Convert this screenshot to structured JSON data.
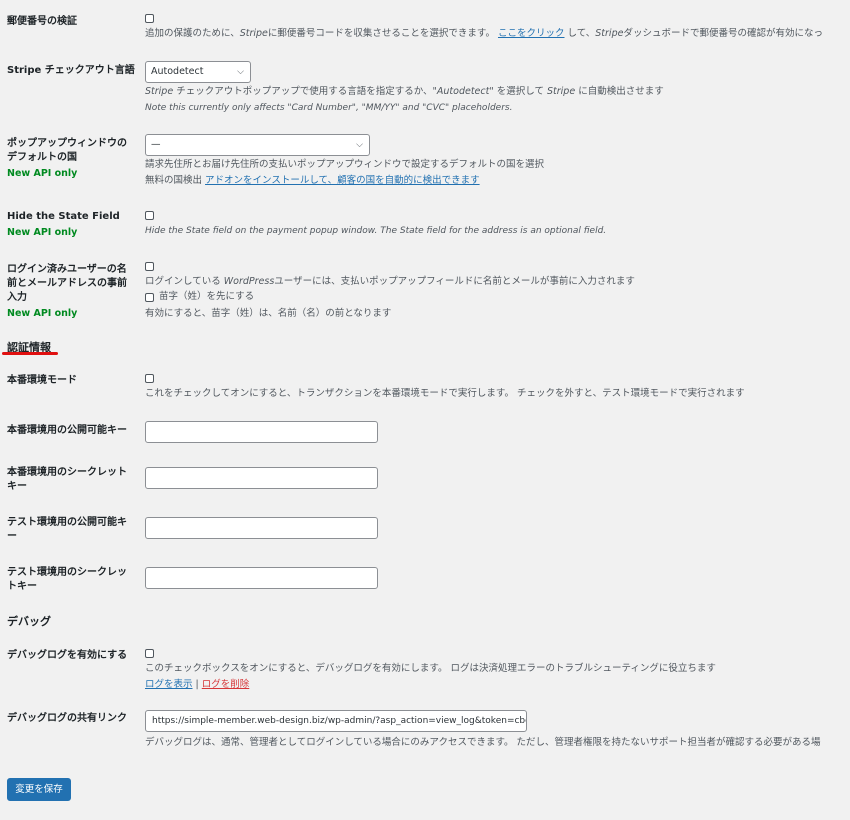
{
  "postal": {
    "label": "郵便番号の検証",
    "desc_pre": "追加の保護のために、",
    "desc_stripe": "Stripe",
    "desc_mid": "に郵便番号コードを収集させることを選択できます。 ",
    "desc_link": "ここをクリック",
    "desc_post": " して、",
    "desc_stripe2": "Stripe",
    "desc_end": "ダッシュボードで郵便番号の確認が有効になっ"
  },
  "checkout_lang": {
    "label": "Stripe チェックアウト言語",
    "value": "Autodetect",
    "desc1_a": "Stripe",
    "desc1_b": " チェックアウトポップアップで使用する言語を指定するか、",
    "desc1_c": "\"Autodetect\"",
    "desc1_d": " を選択して ",
    "desc1_e": "Stripe",
    "desc1_f": " に自動検出させます",
    "desc2": "Note this currently only affects \"Card Number\", \"MM/YY\" and \"CVC\" placeholders."
  },
  "default_country": {
    "label": "ポップアップウィンドウのデフォルトの国",
    "badge": "New API only",
    "value": "—",
    "desc1": "請求先住所とお届け先住所の支払いポップアップウィンドウで設定するデフォルトの国を選択",
    "desc2_pre": "無料の国検出 ",
    "desc2_link": "アドオンをインストールして、顧客の国を自動的に検出できます"
  },
  "hide_state": {
    "label": "Hide the State Field",
    "badge": "New API only",
    "desc": "Hide the State field on the payment popup window. The State field for the address is an optional field."
  },
  "prefill": {
    "label": "ログイン済みユーザーの名前とメールアドレスの事前入力",
    "badge": "New API only",
    "desc_a": "ログインしている ",
    "desc_b": "WordPress",
    "desc_c": "ユーザーには、支払いポップアップフィールドに名前とメールが事前に入力されます",
    "sub_label": "苗字（姓）を先にする",
    "sub_desc": "有効にすると、苗字（姓）は、名前（名）の前となります"
  },
  "auth_section": {
    "title": "認証情報"
  },
  "live_mode": {
    "label": "本番環境モード",
    "desc": "これをチェックしてオンにすると、トランザクションを本番環境モードで実行します。 チェックを外すと、テスト環境モードで実行されます"
  },
  "live_pub": {
    "label": "本番環境用の公開可能キー",
    "value": ""
  },
  "live_secret": {
    "label": "本番環境用のシークレットキー",
    "value": ""
  },
  "test_pub": {
    "label": "テスト環境用の公開可能キー",
    "value": ""
  },
  "test_secret": {
    "label": "テスト環境用のシークレットキー",
    "value": ""
  },
  "debug_section": {
    "title": "デバッグ"
  },
  "debug_enable": {
    "label": "デバッグログを有効にする",
    "desc": "このチェックボックスをオンにすると、デバッグログを有効にします。 ログは決済処理エラーのトラブルシューティングに役立ちます",
    "view_link": "ログを表示",
    "sep": " | ",
    "delete_link": "ログを削除"
  },
  "debug_share": {
    "label": "デバッグログの共有リンク",
    "value": "https://simple-member.web-design.biz/wp-admin/?asp_action=view_log&token=cbd",
    "desc": "デバッグログは、通常、管理者としてログインしている場合にのみアクセスできます。 ただし、管理者権限を持たないサポート担当者が確認する必要がある場"
  },
  "save": {
    "label": "変更を保存"
  },
  "colors": {
    "accent": "#2271b1",
    "new_api": "#008a20",
    "danger": "#d63638",
    "highlight": "#e01010"
  }
}
